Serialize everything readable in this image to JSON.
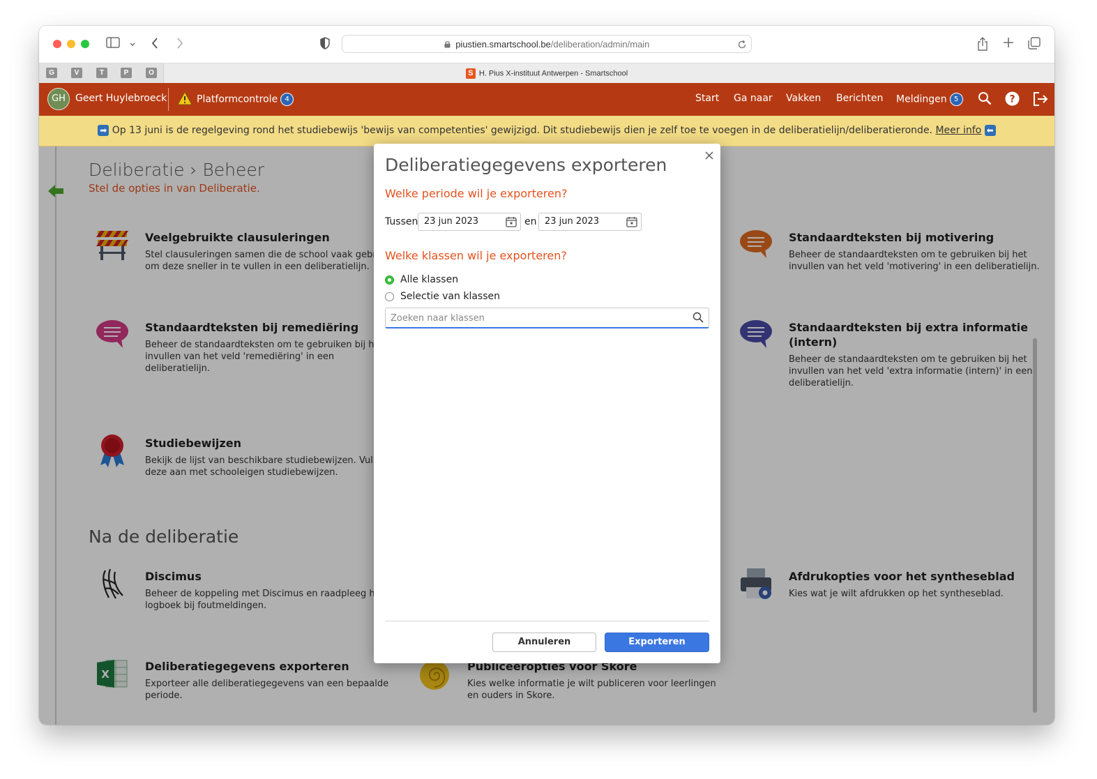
{
  "browser": {
    "url_host": "piustien.smartschool.be",
    "url_path": "/deliberation/admin/main",
    "favorites": [
      "G",
      "V",
      "T",
      "P",
      "O"
    ],
    "tab_logo": "S",
    "tab_title": "H. Pius X-instituut Antwerpen - Smartschool"
  },
  "nav": {
    "avatar_initials": "GH",
    "user_name": "Geert Huylebroeck",
    "platform_label": "Platformcontrole",
    "platform_count": "4",
    "items": [
      "Start",
      "Ga naar",
      "Vakken",
      "Berichten",
      "Meldingen"
    ],
    "notifications_count": "5"
  },
  "notice": {
    "text": "Op 13 juni is de regelgeving rond het studiebewijs 'bewijs van competenties' gewijzigd. Dit studiebewijs dien je zelf toe te voegen in de deliberatielijn/deliberatieronde.",
    "link": "Meer info"
  },
  "page": {
    "title": "Deliberatie › Beheer",
    "subtitle": "Stel de opties in van Deliberatie.",
    "section_after": "Na de deliberatie"
  },
  "cards": [
    {
      "title": "Veelgebruikte clausuleringen",
      "desc": "Stel clausuleringen samen die de school vaak gebruikt om deze sneller in te vullen in een deliberatielijn.",
      "icon": "barrier-icon"
    },
    {
      "title": "Standaardteksten bij motivering",
      "desc": "Beheer de standaardteksten om te gebruiken bij het invullen van het veld 'motivering' in een deliberatielijn.",
      "icon": "speech-bubble-orange-icon"
    },
    {
      "title": "Standaardteksten bij remediëring",
      "desc": "Beheer de standaardteksten om te gebruiken bij het invullen van het veld 'remediëring' in een deliberatielijn.",
      "icon": "speech-bubble-pink-icon"
    },
    {
      "title": "Standaardteksten bij extra informatie (intern)",
      "desc": "Beheer de standaardteksten om te gebruiken bij het invullen van het veld 'extra informatie (intern)' in een deliberatielijn.",
      "icon": "speech-bubble-purple-icon"
    },
    {
      "title": "Studiebewijzen",
      "desc": "Bekijk de lijst van beschikbare studiebewijzen. Vul deze aan met schooleigen studiebewijzen.",
      "icon": "ribbon-seal-icon"
    },
    {
      "title": "Discimus",
      "desc": "Beheer de koppeling met Discimus en raadpleeg het logboek bij foutmeldingen.",
      "icon": "discimus-icon"
    },
    {
      "title": "Afdrukopties voor het syntheseblad",
      "desc": "Kies wat je wilt afdrukken op het syntheseblad.",
      "icon": "printer-gear-icon"
    },
    {
      "title": "Deliberatiegegevens exporteren",
      "desc": "Exporteer alle deliberatiegegevens van een bepaalde periode.",
      "icon": "excel-icon"
    },
    {
      "title": "Publiceeropties voor Skore",
      "desc": "Kies welke informatie je wilt publiceren voor leerlingen en ouders in Skore.",
      "icon": "skore-shell-icon"
    }
  ],
  "modal": {
    "title": "Deliberatiegegevens exporteren",
    "period_question": "Welke periode wil je exporteren?",
    "between_label": "Tussen",
    "start_date": "23 jun 2023",
    "and_label": "en",
    "end_date": "23 jun 2023",
    "classes_question": "Welke klassen wil je exporteren?",
    "option_all": "Alle klassen",
    "option_selection": "Selectie van klassen",
    "search_placeholder": "Zoeken naar klassen",
    "cancel_label": "Annuleren",
    "export_label": "Exporteren"
  },
  "colors": {
    "nav_bg": "#b53a13",
    "notice_bg": "#f3dc86",
    "accent_orange": "#e4521e",
    "primary_button": "#3b77e0",
    "radio_on": "#3fc23f"
  }
}
